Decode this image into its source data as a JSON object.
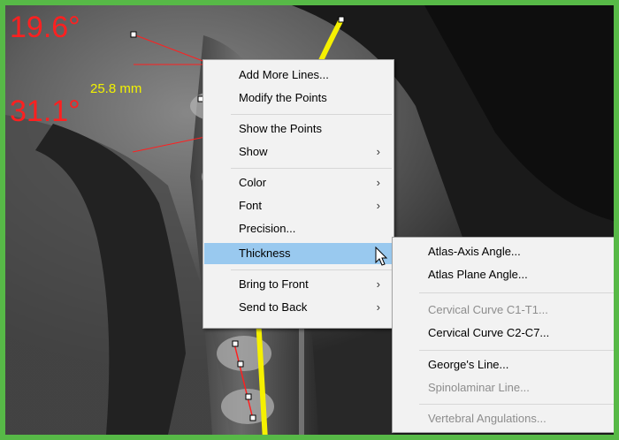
{
  "measurements": {
    "angle_top": "19.6°",
    "angle_mid": "31.1°",
    "distance": "25.8 mm"
  },
  "colors": {
    "frame": "#57b947",
    "angle_text": "#ff2020",
    "distance_text": "#f2f200",
    "curve": "#f5f000",
    "highlight": "#99c9ef"
  },
  "context_menu": {
    "items": [
      {
        "label": "Add More Lines..."
      },
      {
        "label": "Modify the Points"
      },
      {
        "label": "Show the Points"
      },
      {
        "label": "Show",
        "submenu_arrow": "›"
      },
      {
        "label": "Color",
        "submenu_arrow": "›"
      },
      {
        "label": "Font",
        "submenu_arrow": "›"
      },
      {
        "label": "Precision..."
      },
      {
        "label": "Thickness",
        "submenu_arrow": "›",
        "highlighted": true
      },
      {
        "label": "Bring to Front",
        "submenu_arrow": "›"
      },
      {
        "label": "Send to Back",
        "submenu_arrow": "›"
      }
    ]
  },
  "submenu": {
    "items": [
      {
        "label": "Atlas-Axis Angle..."
      },
      {
        "label": "Atlas Plane Angle..."
      },
      {
        "label": "Cervical Curve C1-T1...",
        "disabled": true
      },
      {
        "label": "Cervical Curve C2-C7..."
      },
      {
        "label": "George's Line..."
      },
      {
        "label": "Spinolaminar Line...",
        "disabled": true
      },
      {
        "label": "Vertebral Angulations...",
        "disabled": true
      }
    ]
  }
}
